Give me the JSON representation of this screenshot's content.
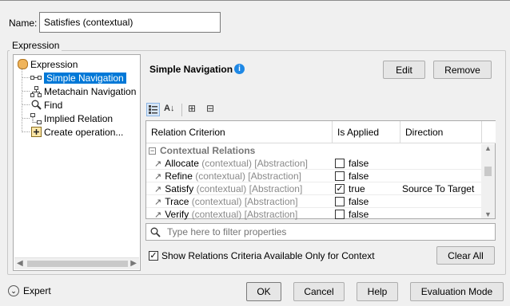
{
  "name": {
    "label": "Name:",
    "value": "Satisfies (contextual)"
  },
  "expression": {
    "group_label": "Expression",
    "tree": [
      {
        "label": "Expression",
        "icon": "expression-icon",
        "selected": false
      },
      {
        "label": "Simple Navigation",
        "icon": "simple-navigation-icon",
        "selected": true
      },
      {
        "label": "Metachain Navigation",
        "icon": "metachain-navigation-icon",
        "selected": false
      },
      {
        "label": "Find",
        "icon": "find-icon",
        "selected": false
      },
      {
        "label": "Implied Relation",
        "icon": "implied-relation-icon",
        "selected": false
      },
      {
        "label": "Create operation...",
        "icon": "create-operation-icon",
        "selected": false
      }
    ]
  },
  "panel": {
    "title": "Simple Navigation",
    "edit_label": "Edit",
    "remove_label": "Remove"
  },
  "table": {
    "columns": [
      "Relation Criterion",
      "Is Applied",
      "Direction"
    ],
    "group": "Contextual Relations",
    "rows": [
      {
        "name": "Allocate",
        "context": "(contextual) [Abstraction]",
        "checked": false,
        "applied": "false",
        "direction": ""
      },
      {
        "name": "Refine",
        "context": "(contextual) [Abstraction]",
        "checked": false,
        "applied": "false",
        "direction": ""
      },
      {
        "name": "Satisfy",
        "context": "(contextual) [Abstraction]",
        "checked": true,
        "applied": "true",
        "direction": "Source To Target"
      },
      {
        "name": "Trace",
        "context": "(contextual) [Abstraction]",
        "checked": false,
        "applied": "false",
        "direction": ""
      },
      {
        "name": "Verify",
        "context": "(contextual) [Abstraction]",
        "checked": false,
        "applied": "false",
        "direction": ""
      }
    ]
  },
  "filter": {
    "placeholder": "Type here to filter properties"
  },
  "show_only_context": {
    "label": "Show Relations Criteria Available Only for Context",
    "checked": true
  },
  "clear_all_label": "Clear All",
  "footer": {
    "expert_label": "Expert",
    "ok_label": "OK",
    "cancel_label": "Cancel",
    "help_label": "Help",
    "evaluation_mode_label": "Evaluation Mode"
  },
  "colors": {
    "selection": "#0078d7",
    "info": "#1e88e5",
    "expression_icon": "#f0b45a"
  }
}
